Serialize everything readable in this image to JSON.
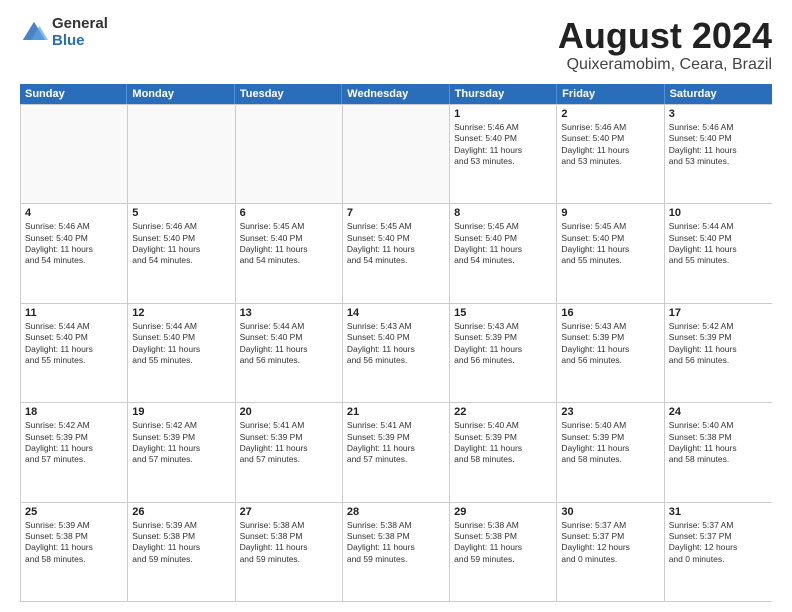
{
  "logo": {
    "general": "General",
    "blue": "Blue"
  },
  "title": {
    "month_year": "August 2024",
    "location": "Quixeramobim, Ceara, Brazil"
  },
  "days_of_week": [
    "Sunday",
    "Monday",
    "Tuesday",
    "Wednesday",
    "Thursday",
    "Friday",
    "Saturday"
  ],
  "weeks": [
    [
      {
        "day": "",
        "info": "",
        "empty": true
      },
      {
        "day": "",
        "info": "",
        "empty": true
      },
      {
        "day": "",
        "info": "",
        "empty": true
      },
      {
        "day": "",
        "info": "",
        "empty": true
      },
      {
        "day": "1",
        "info": "Sunrise: 5:46 AM\nSunset: 5:40 PM\nDaylight: 11 hours\nand 53 minutes.",
        "empty": false
      },
      {
        "day": "2",
        "info": "Sunrise: 5:46 AM\nSunset: 5:40 PM\nDaylight: 11 hours\nand 53 minutes.",
        "empty": false
      },
      {
        "day": "3",
        "info": "Sunrise: 5:46 AM\nSunset: 5:40 PM\nDaylight: 11 hours\nand 53 minutes.",
        "empty": false
      }
    ],
    [
      {
        "day": "4",
        "info": "Sunrise: 5:46 AM\nSunset: 5:40 PM\nDaylight: 11 hours\nand 54 minutes.",
        "empty": false
      },
      {
        "day": "5",
        "info": "Sunrise: 5:46 AM\nSunset: 5:40 PM\nDaylight: 11 hours\nand 54 minutes.",
        "empty": false
      },
      {
        "day": "6",
        "info": "Sunrise: 5:45 AM\nSunset: 5:40 PM\nDaylight: 11 hours\nand 54 minutes.",
        "empty": false
      },
      {
        "day": "7",
        "info": "Sunrise: 5:45 AM\nSunset: 5:40 PM\nDaylight: 11 hours\nand 54 minutes.",
        "empty": false
      },
      {
        "day": "8",
        "info": "Sunrise: 5:45 AM\nSunset: 5:40 PM\nDaylight: 11 hours\nand 54 minutes.",
        "empty": false
      },
      {
        "day": "9",
        "info": "Sunrise: 5:45 AM\nSunset: 5:40 PM\nDaylight: 11 hours\nand 55 minutes.",
        "empty": false
      },
      {
        "day": "10",
        "info": "Sunrise: 5:44 AM\nSunset: 5:40 PM\nDaylight: 11 hours\nand 55 minutes.",
        "empty": false
      }
    ],
    [
      {
        "day": "11",
        "info": "Sunrise: 5:44 AM\nSunset: 5:40 PM\nDaylight: 11 hours\nand 55 minutes.",
        "empty": false
      },
      {
        "day": "12",
        "info": "Sunrise: 5:44 AM\nSunset: 5:40 PM\nDaylight: 11 hours\nand 55 minutes.",
        "empty": false
      },
      {
        "day": "13",
        "info": "Sunrise: 5:44 AM\nSunset: 5:40 PM\nDaylight: 11 hours\nand 56 minutes.",
        "empty": false
      },
      {
        "day": "14",
        "info": "Sunrise: 5:43 AM\nSunset: 5:40 PM\nDaylight: 11 hours\nand 56 minutes.",
        "empty": false
      },
      {
        "day": "15",
        "info": "Sunrise: 5:43 AM\nSunset: 5:39 PM\nDaylight: 11 hours\nand 56 minutes.",
        "empty": false
      },
      {
        "day": "16",
        "info": "Sunrise: 5:43 AM\nSunset: 5:39 PM\nDaylight: 11 hours\nand 56 minutes.",
        "empty": false
      },
      {
        "day": "17",
        "info": "Sunrise: 5:42 AM\nSunset: 5:39 PM\nDaylight: 11 hours\nand 56 minutes.",
        "empty": false
      }
    ],
    [
      {
        "day": "18",
        "info": "Sunrise: 5:42 AM\nSunset: 5:39 PM\nDaylight: 11 hours\nand 57 minutes.",
        "empty": false
      },
      {
        "day": "19",
        "info": "Sunrise: 5:42 AM\nSunset: 5:39 PM\nDaylight: 11 hours\nand 57 minutes.",
        "empty": false
      },
      {
        "day": "20",
        "info": "Sunrise: 5:41 AM\nSunset: 5:39 PM\nDaylight: 11 hours\nand 57 minutes.",
        "empty": false
      },
      {
        "day": "21",
        "info": "Sunrise: 5:41 AM\nSunset: 5:39 PM\nDaylight: 11 hours\nand 57 minutes.",
        "empty": false
      },
      {
        "day": "22",
        "info": "Sunrise: 5:40 AM\nSunset: 5:39 PM\nDaylight: 11 hours\nand 58 minutes.",
        "empty": false
      },
      {
        "day": "23",
        "info": "Sunrise: 5:40 AM\nSunset: 5:39 PM\nDaylight: 11 hours\nand 58 minutes.",
        "empty": false
      },
      {
        "day": "24",
        "info": "Sunrise: 5:40 AM\nSunset: 5:38 PM\nDaylight: 11 hours\nand 58 minutes.",
        "empty": false
      }
    ],
    [
      {
        "day": "25",
        "info": "Sunrise: 5:39 AM\nSunset: 5:38 PM\nDaylight: 11 hours\nand 58 minutes.",
        "empty": false
      },
      {
        "day": "26",
        "info": "Sunrise: 5:39 AM\nSunset: 5:38 PM\nDaylight: 11 hours\nand 59 minutes.",
        "empty": false
      },
      {
        "day": "27",
        "info": "Sunrise: 5:38 AM\nSunset: 5:38 PM\nDaylight: 11 hours\nand 59 minutes.",
        "empty": false
      },
      {
        "day": "28",
        "info": "Sunrise: 5:38 AM\nSunset: 5:38 PM\nDaylight: 11 hours\nand 59 minutes.",
        "empty": false
      },
      {
        "day": "29",
        "info": "Sunrise: 5:38 AM\nSunset: 5:38 PM\nDaylight: 11 hours\nand 59 minutes.",
        "empty": false
      },
      {
        "day": "30",
        "info": "Sunrise: 5:37 AM\nSunset: 5:37 PM\nDaylight: 12 hours\nand 0 minutes.",
        "empty": false
      },
      {
        "day": "31",
        "info": "Sunrise: 5:37 AM\nSunset: 5:37 PM\nDaylight: 12 hours\nand 0 minutes.",
        "empty": false
      }
    ]
  ]
}
